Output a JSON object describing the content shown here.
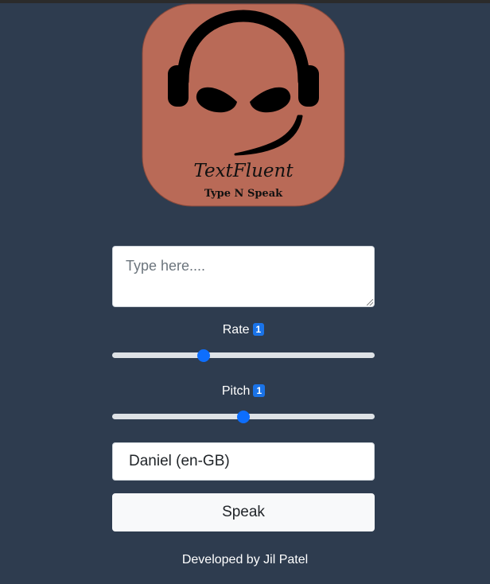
{
  "logo": {
    "title": "TextFluent",
    "subtitle": "Type N Speak",
    "background_color": "#b96a57",
    "icon": "headset-face-icon"
  },
  "text_input": {
    "placeholder": "Type here....",
    "value": ""
  },
  "rate": {
    "label": "Rate",
    "value": "1",
    "min": 0.5,
    "max": 2,
    "fraction": 0.34
  },
  "pitch": {
    "label": "Pitch",
    "value": "1",
    "min": 0,
    "max": 2,
    "fraction": 0.5
  },
  "voice_select": {
    "selected": "Daniel (en-GB)"
  },
  "speak_button": {
    "label": "Speak"
  },
  "footer": {
    "text": "Developed by Jil Patel"
  },
  "colors": {
    "page_background": "#2e3c4f",
    "accent": "#0d6efd",
    "badge": "#1a73e8"
  }
}
